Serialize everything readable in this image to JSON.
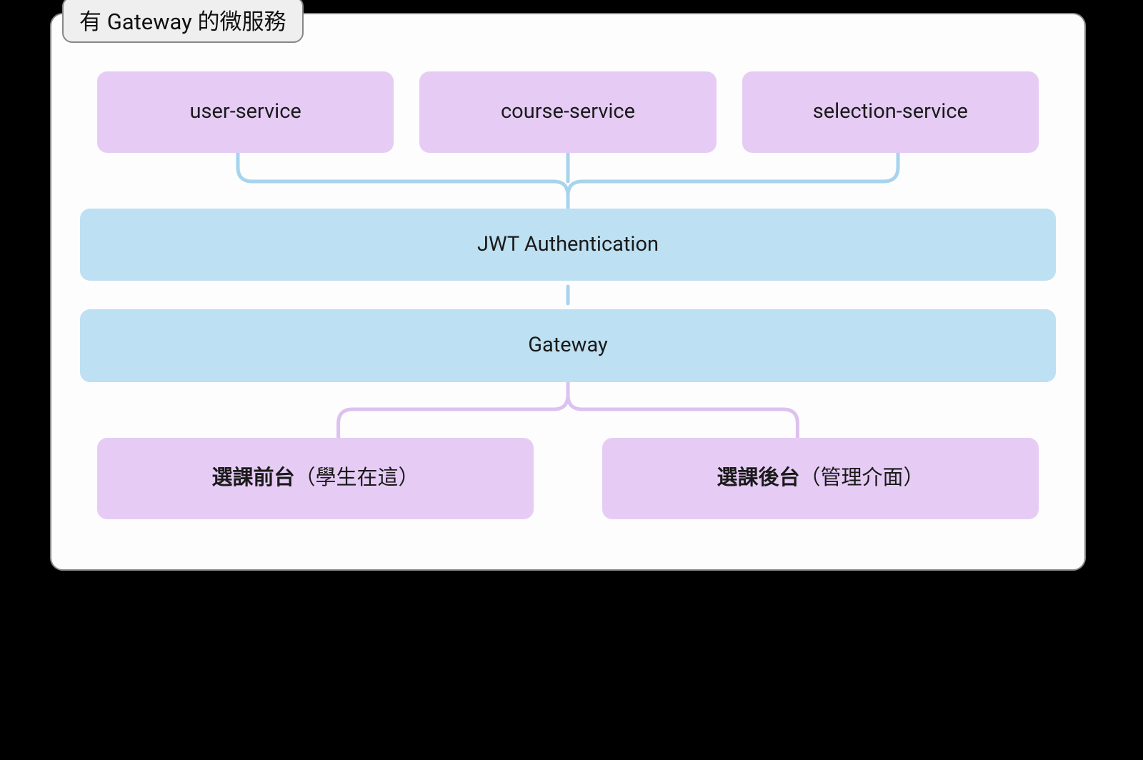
{
  "diagram": {
    "title": "有 Gateway 的微服務",
    "services": [
      {
        "label": "user-service"
      },
      {
        "label": "course-service"
      },
      {
        "label": "selection-service"
      }
    ],
    "auth": {
      "label": "JWT Authentication"
    },
    "gateway": {
      "label": "Gateway"
    },
    "frontends": [
      {
        "bold": "選課前台",
        "note": "（學生在這）"
      },
      {
        "bold": "選課後台",
        "note": "（管理介面）"
      }
    ],
    "colors": {
      "purple": "#e6ccf5",
      "blue": "#bde0f2",
      "connector_blue": "#a7d4ed",
      "connector_purple": "#dcc2ef",
      "border": "#878787",
      "tab_bg": "#efefef"
    }
  }
}
